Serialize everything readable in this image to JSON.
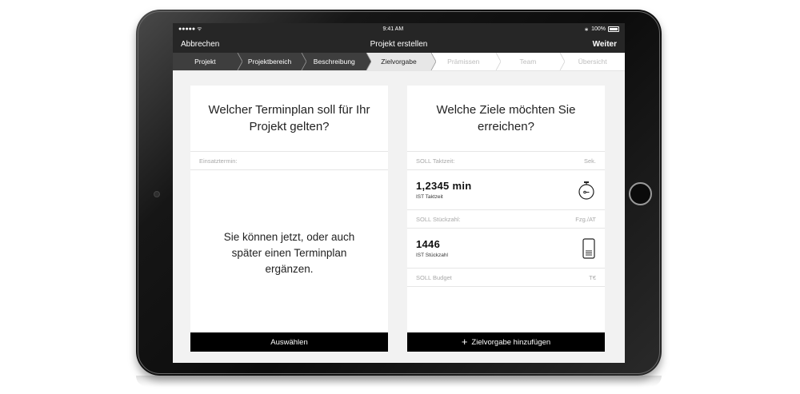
{
  "statusbar": {
    "signal": "●●●●● ᯤ",
    "time": "9:41 AM",
    "bluetooth": "∗",
    "battery": "100%"
  },
  "navbar": {
    "cancel": "Abbrechen",
    "title": "Projekt erstellen",
    "next": "Weiter"
  },
  "steps": [
    {
      "label": "Projekt",
      "state": "done"
    },
    {
      "label": "Projektbereich",
      "state": "done"
    },
    {
      "label": "Beschreibung",
      "state": "done"
    },
    {
      "label": "Zielvorgabe",
      "state": "active"
    },
    {
      "label": "Prämissen",
      "state": "upcoming"
    },
    {
      "label": "Team",
      "state": "upcoming"
    },
    {
      "label": "Übersicht",
      "state": "upcoming"
    }
  ],
  "left_card": {
    "question": "Welcher Terminplan soll für Ihr Projekt gelten?",
    "field_label": "Einsatztermin:",
    "empty_text": "Sie können jetzt, oder auch später einen Terminplan ergänzen.",
    "action": "Auswählen"
  },
  "right_card": {
    "question": "Welche Ziele möchten Sie erreichen?",
    "takt": {
      "label": "SOLL Taktzeit:",
      "unit": "Sek.",
      "value": "1,2345 min",
      "sub": "IST Taktzeit",
      "icon": "stopwatch-icon"
    },
    "stueck": {
      "label": "SOLL Stückzahl:",
      "unit": "Fzg./AT",
      "value": "1446",
      "sub": "IST Stückzahl",
      "icon": "device-icon"
    },
    "budget": {
      "label": "SOLL Budget",
      "unit": "T€"
    },
    "action": "Zielvorgabe hinzufügen"
  }
}
